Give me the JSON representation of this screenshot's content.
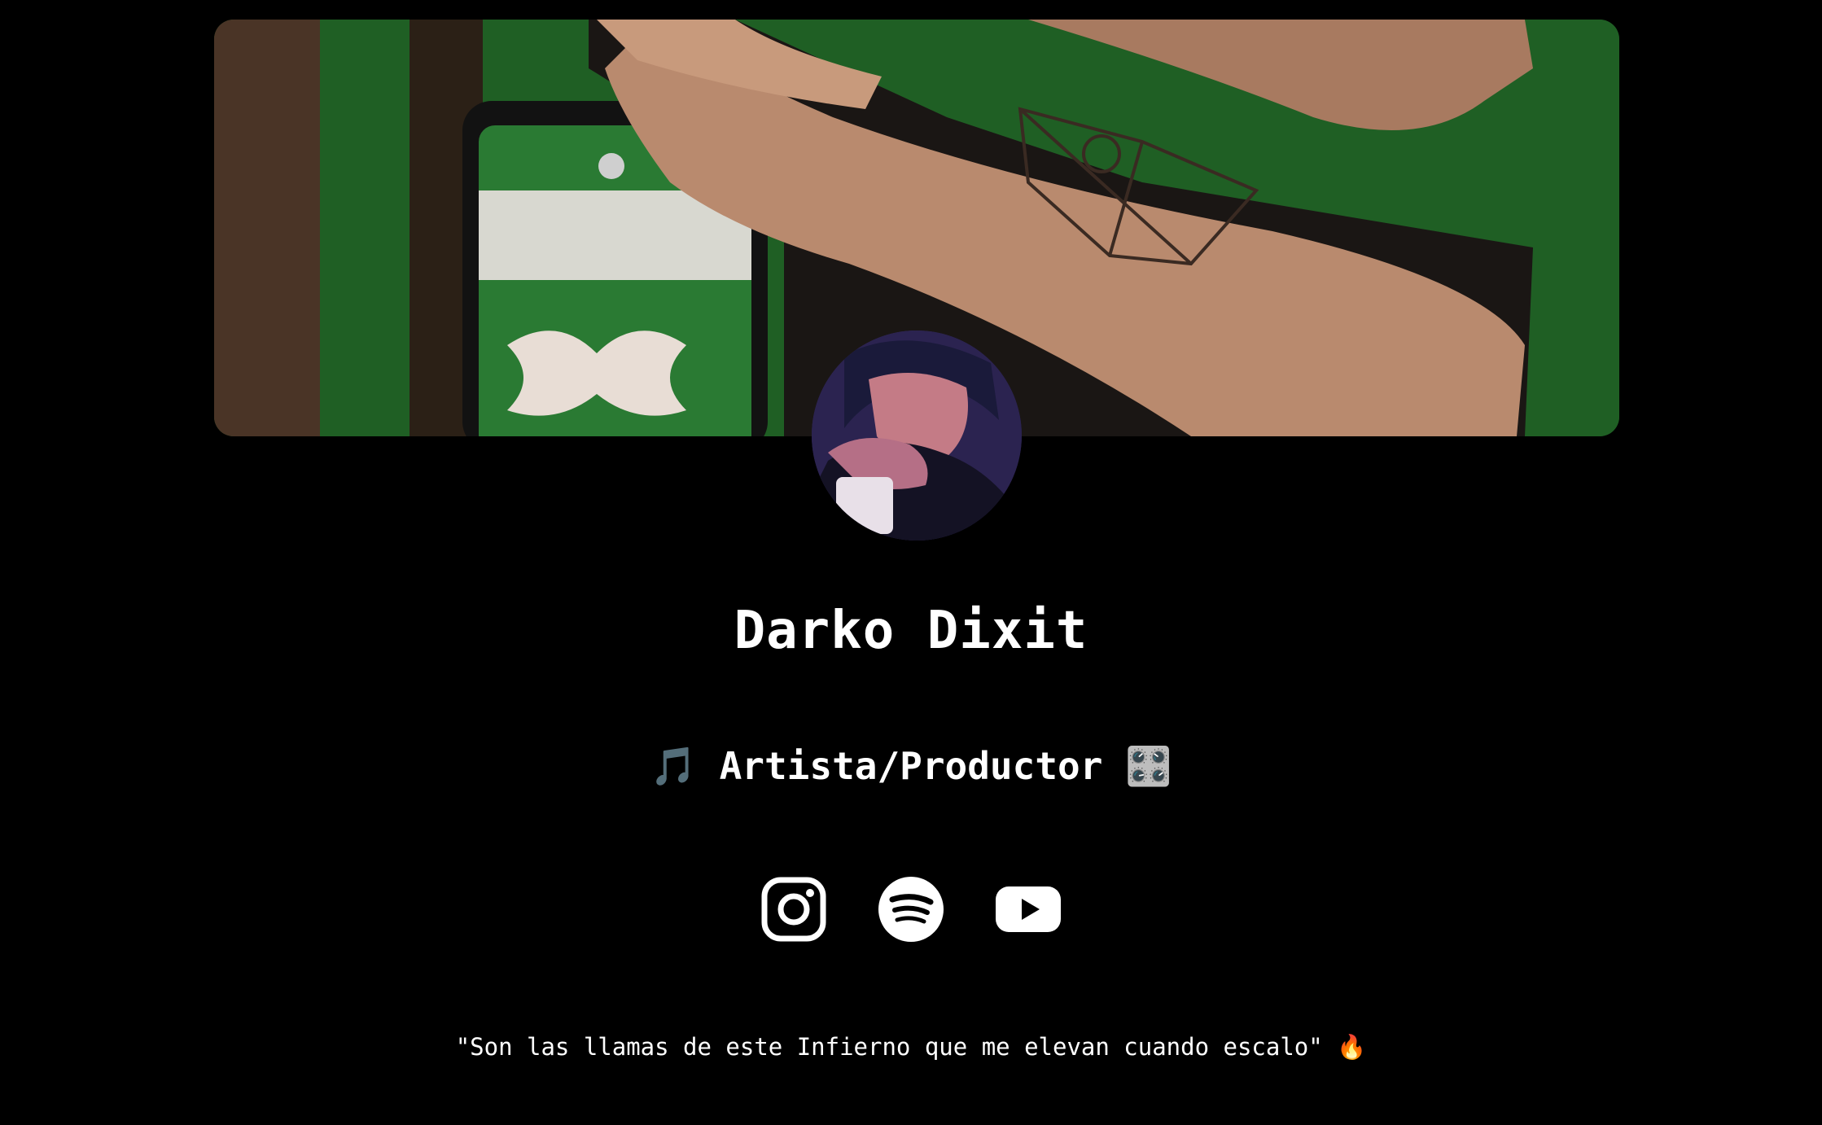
{
  "profile": {
    "name": "Darko Dixit",
    "subtitle_left_emoji": "🎵",
    "subtitle": "Artista/Productor",
    "subtitle_right_emoji": "🎛️",
    "quote": "\"Son las llamas de este Infierno que me elevan cuando escalo\"",
    "quote_emoji": "🔥"
  },
  "socials": [
    {
      "icon": "instagram-icon"
    },
    {
      "icon": "spotify-icon"
    },
    {
      "icon": "youtube-icon"
    }
  ],
  "colors": {
    "background": "#000000",
    "text": "#ffffff"
  }
}
